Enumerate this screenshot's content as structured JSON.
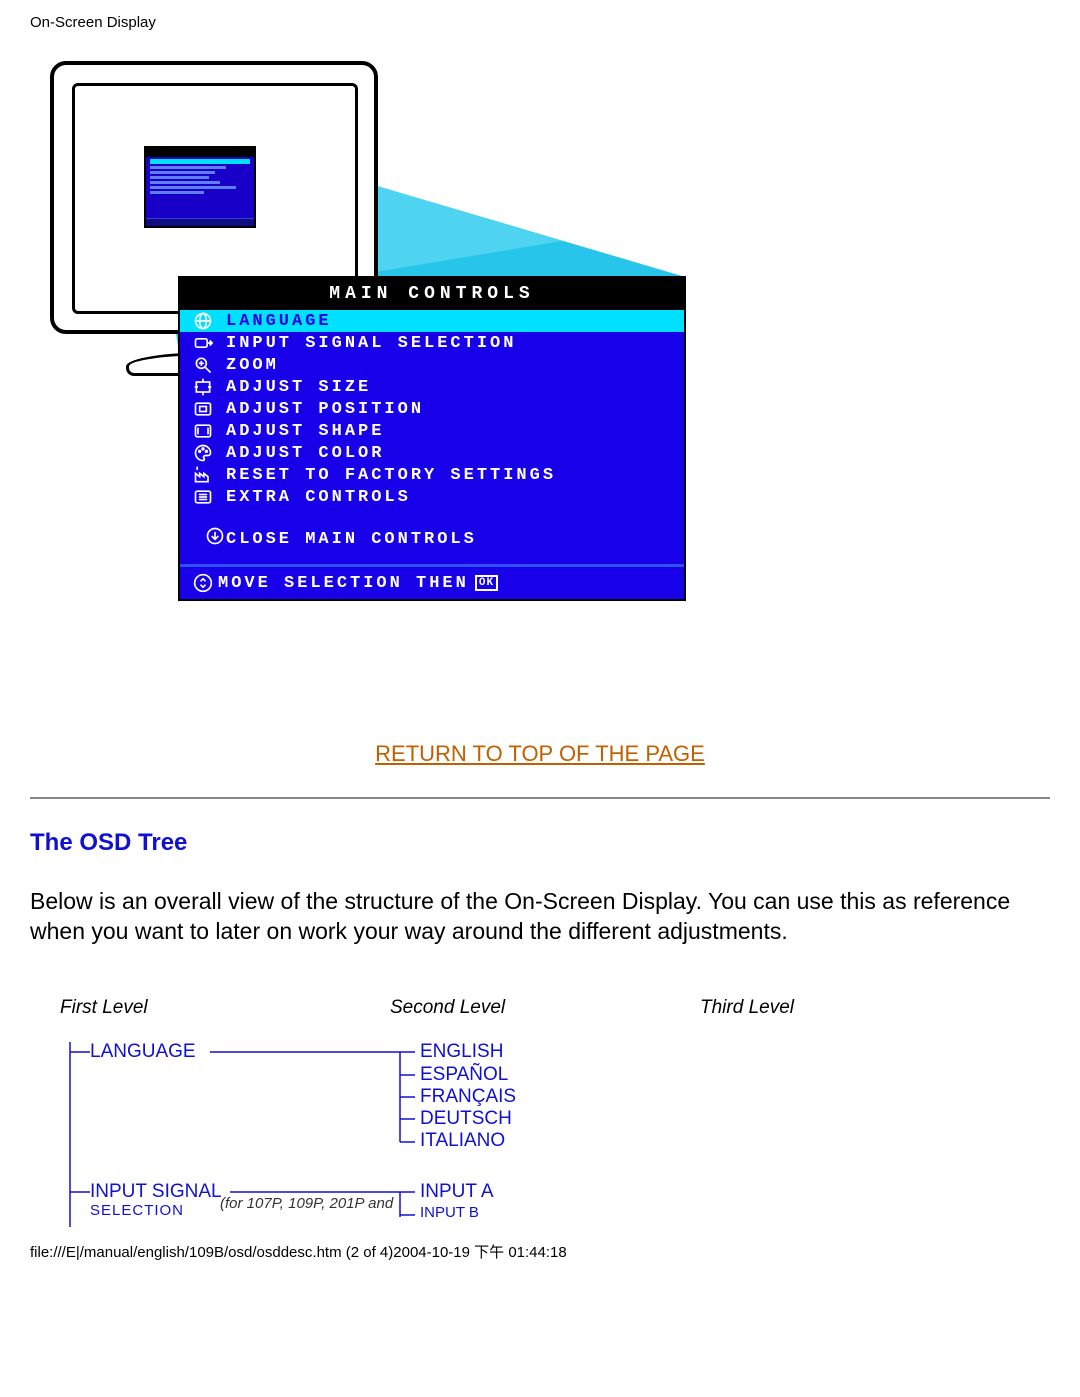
{
  "header": {
    "title": "On-Screen Display"
  },
  "osd": {
    "title": "MAIN CONTROLS",
    "items": [
      {
        "label": "LANGUAGE",
        "highlight": true
      },
      {
        "label": "INPUT SIGNAL SELECTION"
      },
      {
        "label": "ZOOM"
      },
      {
        "label": "ADJUST SIZE"
      },
      {
        "label": "ADJUST POSITION"
      },
      {
        "label": "ADJUST SHAPE"
      },
      {
        "label": "ADJUST COLOR"
      },
      {
        "label": "RESET TO FACTORY SETTINGS"
      },
      {
        "label": "EXTRA CONTROLS"
      }
    ],
    "close": "CLOSE MAIN CONTROLS",
    "footer_prefix": "MOVE SELECTION THEN",
    "footer_ok": "OK"
  },
  "return_link": "RETURN TO TOP OF THE PAGE",
  "section": {
    "title": "The OSD Tree",
    "body": "Below is an overall view of the structure of the On-Screen Display. You can use this as reference when you want to later on work your way around the different adjustments."
  },
  "tree": {
    "levels": {
      "first": "First Level",
      "second": "Second Level",
      "third": "Third Level"
    },
    "first_items": [
      {
        "label": "LANGUAGE"
      },
      {
        "label": "INPUT SIGNAL",
        "sub_partial": "SELECTION",
        "note": "(for 107P, 109P, 201P and"
      }
    ],
    "second_groups": [
      {
        "items": [
          "ENGLISH",
          "ESPAÑOL",
          "FRANÇAIS",
          "DEUTSCH",
          "ITALIANO"
        ]
      },
      {
        "items": [
          "INPUT A",
          "INPUT B"
        ],
        "partial_second": true
      }
    ]
  },
  "footer": {
    "path": "file:///E|/manual/english/109B/osd/osddesc.htm (2 of 4)2004-10-19 下午 01:44:18"
  }
}
